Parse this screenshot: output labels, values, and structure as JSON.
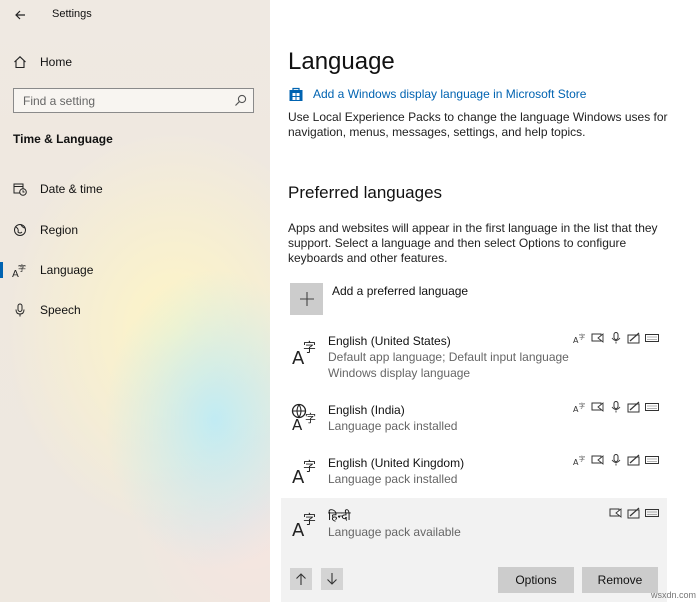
{
  "window": {
    "title": "Settings"
  },
  "sidebar": {
    "home_label": "Home",
    "search_placeholder": "Find a setting",
    "section_title": "Time & Language",
    "items": [
      {
        "label": "Date & time",
        "icon": "calendar-clock-icon"
      },
      {
        "label": "Region",
        "icon": "globe-icon"
      },
      {
        "label": "Language",
        "icon": "language-icon",
        "active": true
      },
      {
        "label": "Speech",
        "icon": "microphone-icon"
      }
    ]
  },
  "main": {
    "title": "Language",
    "store_link": "Add a Windows display language in Microsoft Store",
    "description": "Use Local Experience Packs to change the language Windows uses for navigation, menus, messages, settings, and help topics.",
    "preferred_title": "Preferred languages",
    "preferred_desc": "Apps and websites will appear in the first language in the list that they support. Select a language and then select Options to configure keyboards and other features.",
    "add_label": "Add a preferred language",
    "languages": [
      {
        "name": "English (United States)",
        "status": "Default app language; Default input language",
        "status2": "Windows display language"
      },
      {
        "name": "English (India)",
        "status": "Language pack installed"
      },
      {
        "name": "English (United Kingdom)",
        "status": "Language pack installed"
      },
      {
        "name": "हिन्दी",
        "status": "Language pack available"
      }
    ],
    "options_button": "Options",
    "remove_button": "Remove"
  },
  "watermark": "wsxdn.com",
  "colors": {
    "accent": "#0063b1",
    "button": "#cccccc",
    "selected_row": "#f2f2f2"
  }
}
